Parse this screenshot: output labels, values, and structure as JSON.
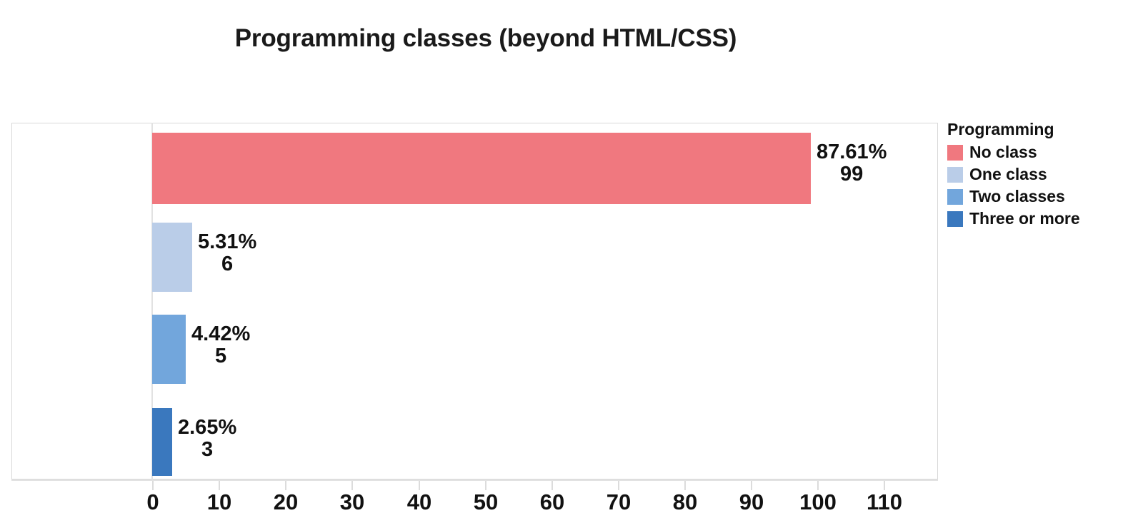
{
  "chart_data": {
    "type": "bar",
    "orientation": "horizontal",
    "title": "Programming classes (beyond HTML/CSS)",
    "xlabel": "",
    "ylabel": "",
    "categories": [
      "No class",
      "One class",
      "Two classes",
      "Three or more"
    ],
    "values": [
      99,
      6,
      5,
      3
    ],
    "percent_labels": [
      "87.61%",
      "5.31%",
      "4.42%",
      "2.65%"
    ],
    "count_labels": [
      "99",
      "6",
      "5",
      "3"
    ],
    "percents": [
      87.61,
      5.31,
      4.42,
      2.65
    ],
    "xlim": [
      0,
      117
    ],
    "xticks": [
      0,
      10,
      20,
      30,
      40,
      50,
      60,
      70,
      80,
      90,
      100,
      110
    ],
    "xtick_labels": [
      "0",
      "10",
      "20",
      "30",
      "40",
      "50",
      "60",
      "70",
      "80",
      "90",
      "100",
      "110"
    ],
    "grid": false,
    "legend_position": "right",
    "colors": [
      "#F0787F",
      "#BACDE8",
      "#72A6DC",
      "#3A78BE"
    ],
    "series": [
      {
        "name": "No class",
        "value": 99,
        "percent": 87.61,
        "color": "#F0787F"
      },
      {
        "name": "One class",
        "value": 6,
        "percent": 5.31,
        "color": "#BACDE8"
      },
      {
        "name": "Two classes",
        "value": 5,
        "percent": 4.42,
        "color": "#72A6DC"
      },
      {
        "name": "Three or more",
        "value": 3,
        "percent": 2.65,
        "color": "#3A78BE"
      }
    ]
  },
  "legend": {
    "title": "Programming",
    "items": [
      {
        "label": "No class",
        "color": "#F0787F"
      },
      {
        "label": "One class",
        "color": "#BACDE8"
      },
      {
        "label": "Two classes",
        "color": "#72A6DC"
      },
      {
        "label": "Three or more",
        "color": "#3A78BE"
      }
    ]
  },
  "category_label_lines": [
    [
      "No class"
    ],
    [
      "One class"
    ],
    [
      "Two",
      "classes"
    ],
    [
      "Three or",
      "more"
    ]
  ]
}
